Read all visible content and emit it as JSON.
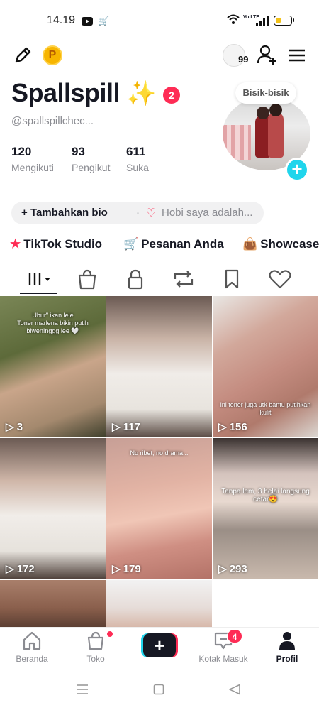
{
  "status_bar": {
    "time": "14.19",
    "network_label": "Vo LTE",
    "battery_level": 0.35
  },
  "header": {
    "viewers_count": "99"
  },
  "profile": {
    "name": "Spallspill",
    "name_emoji": "✨",
    "notification_count": "2",
    "handle": "@spallspillchec...",
    "stats": [
      {
        "value": "120",
        "label": "Mengikuti"
      },
      {
        "value": "93",
        "label": "Pengikut"
      },
      {
        "value": "611",
        "label": "Suka"
      }
    ],
    "whisper_label": "Bisik-bisik",
    "add_bio_label": "Tambahkan bio",
    "hobby_prompt": "Hobi saya adalah..."
  },
  "quick_links": [
    {
      "label": "TikTok Studio"
    },
    {
      "label": "Pesanan Anda"
    },
    {
      "label": "Showcase"
    }
  ],
  "tabs": [
    "videos",
    "shop",
    "private",
    "reposts",
    "favorites",
    "liked"
  ],
  "videos": [
    {
      "views": "3",
      "caption": "Ubur\" ikan lele\nToner marlena bikin putih\nbiwen!nggg lee 🤍"
    },
    {
      "views": "117",
      "caption": ""
    },
    {
      "views": "156",
      "caption": "ini toner juga utk bantu putihkan kulit"
    },
    {
      "views": "172",
      "caption": ""
    },
    {
      "views": "179",
      "caption": "No ribet, no drama..."
    },
    {
      "views": "293",
      "caption": "Tanpa lem, 3 helai langsung cetar😍"
    },
    {
      "views": "",
      "caption": ""
    },
    {
      "views": "",
      "caption": ""
    }
  ],
  "bottom_nav": {
    "home": "Beranda",
    "shop": "Toko",
    "inbox": "Kotak Masuk",
    "inbox_count": "4",
    "profile": "Profil"
  },
  "colors": {
    "accent": "#fe2c55",
    "cyan": "#20d5ec",
    "text": "#161823",
    "muted": "#8a8b91"
  }
}
